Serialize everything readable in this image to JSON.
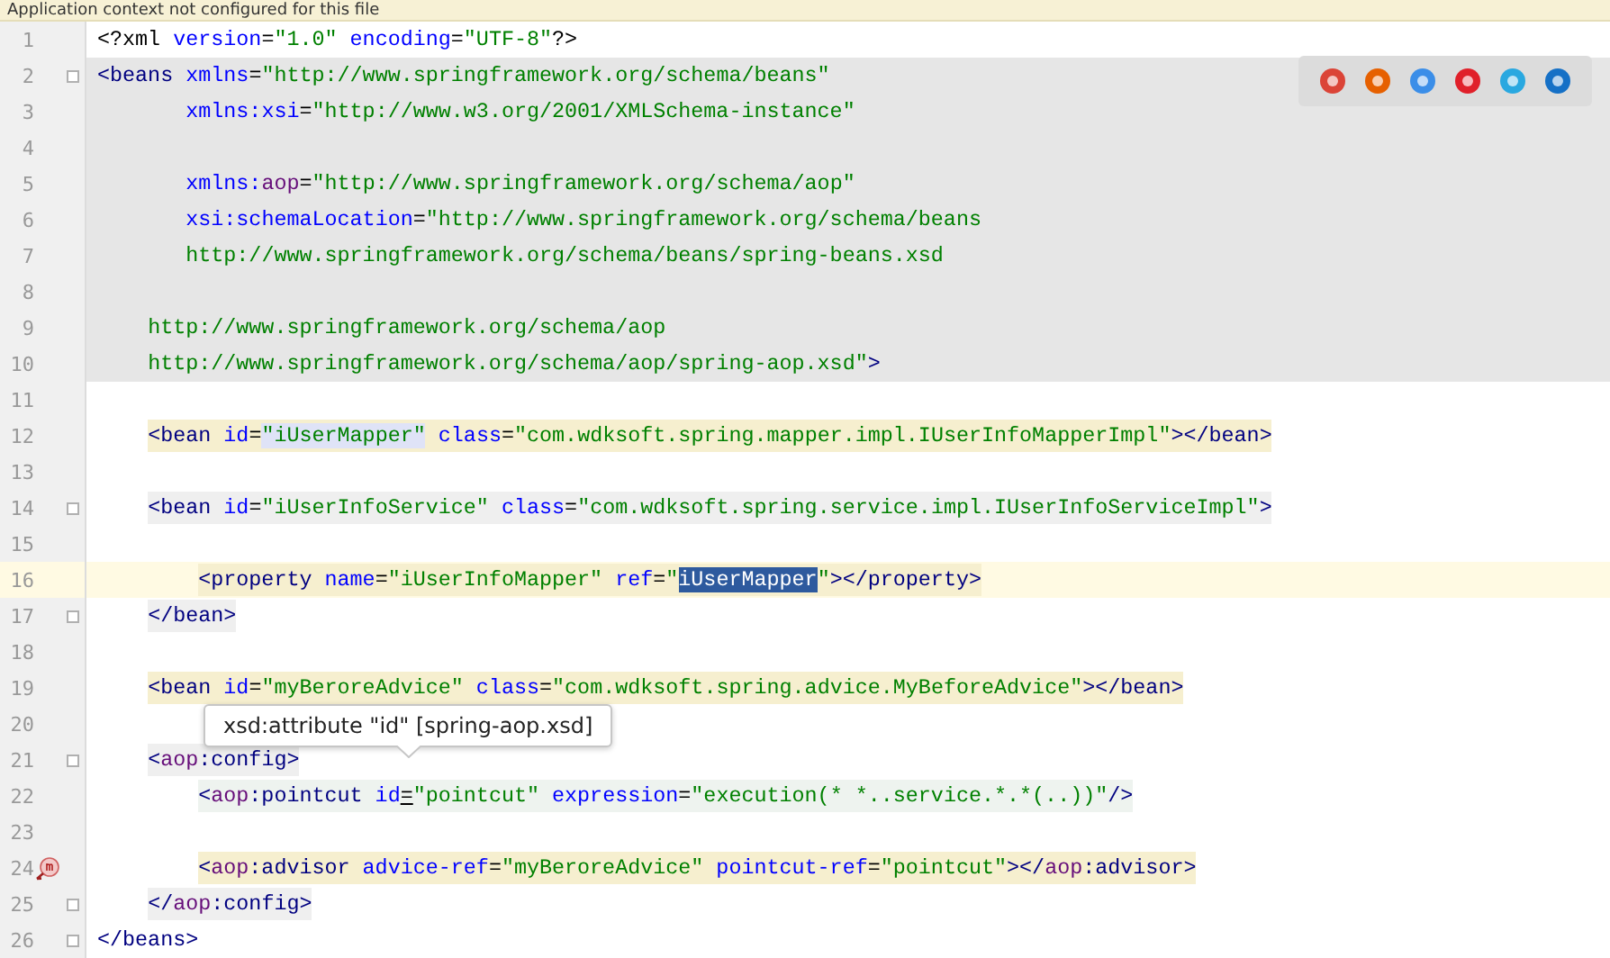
{
  "banner": {
    "text": "Application context not configured for this file"
  },
  "browser_icons": [
    {
      "color": "#db4437"
    },
    {
      "color": "#e66000"
    },
    {
      "color": "#3b8ee8"
    },
    {
      "color": "#e0202a"
    },
    {
      "color": "#29a8e0"
    },
    {
      "color": "#1570c6"
    }
  ],
  "lines": [
    {
      "number": "1",
      "band": false,
      "current": false,
      "fold": false,
      "marker": false,
      "kind": "plain",
      "tokens": [
        {
          "kind": "punct",
          "text": "<?xml"
        },
        {
          "kind": "attr",
          "text": " version"
        },
        {
          "kind": "punct",
          "text": "="
        },
        {
          "kind": "str",
          "text": "\"1.0\""
        },
        {
          "kind": "attr",
          "text": " encoding"
        },
        {
          "kind": "punct",
          "text": "="
        },
        {
          "kind": "str",
          "text": "\"UTF-8\""
        },
        {
          "kind": "punct",
          "text": "?>"
        }
      ]
    },
    {
      "number": "2",
      "band": true,
      "current": false,
      "fold": true,
      "marker": false,
      "kind": "plain",
      "tokens": [
        {
          "kind": "tag",
          "text": "<beans"
        },
        {
          "kind": "attr",
          "text": " xmlns"
        },
        {
          "kind": "punct",
          "text": "="
        },
        {
          "kind": "str",
          "text": "\"http://www.springframework.org/schema/beans\""
        }
      ]
    },
    {
      "number": "3",
      "band": true,
      "current": false,
      "fold": false,
      "marker": false,
      "kind": "plain",
      "tokens": [
        {
          "kind": "attr",
          "text": "       xmlns:xsi"
        },
        {
          "kind": "punct",
          "text": "="
        },
        {
          "kind": "str",
          "text": "\"http://www.w3.org/2001/XMLSchema-instance\""
        }
      ]
    },
    {
      "number": "4",
      "band": true,
      "current": false,
      "fold": false,
      "marker": false
    },
    {
      "number": "5",
      "band": true,
      "current": false,
      "fold": false,
      "marker": false,
      "kind": "plain",
      "tokens": [
        {
          "kind": "attr",
          "text": "       xmlns:"
        },
        {
          "kind": "ns",
          "text": "aop"
        },
        {
          "kind": "punct",
          "text": "="
        },
        {
          "kind": "str",
          "text": "\"http://www.springframework.org/schema/aop\""
        }
      ]
    },
    {
      "number": "6",
      "band": true,
      "current": false,
      "fold": false,
      "marker": false,
      "kind": "plain",
      "tokens": [
        {
          "kind": "attr",
          "text": "       xsi:schemaLocation"
        },
        {
          "kind": "punct",
          "text": "="
        },
        {
          "kind": "str",
          "text": "\"http://www.springframework.org/schema/beans"
        }
      ]
    },
    {
      "number": "7",
      "band": true,
      "current": false,
      "fold": false,
      "marker": false,
      "kind": "plain",
      "tokens": [
        {
          "kind": "str",
          "text": "       http://www.springframework.org/schema/beans/spring-beans.xsd"
        }
      ]
    },
    {
      "number": "8",
      "band": true,
      "current": false,
      "fold": false,
      "marker": false
    },
    {
      "number": "9",
      "band": true,
      "current": false,
      "fold": false,
      "marker": false,
      "kind": "plain",
      "tokens": [
        {
          "kind": "str",
          "text": "    http://www.springframework.org/schema/aop"
        }
      ]
    },
    {
      "number": "10",
      "band": true,
      "current": false,
      "fold": false,
      "marker": false,
      "kind": "plain",
      "tokens": [
        {
          "kind": "str",
          "text": "    http://www.springframework.org/schema/aop/spring-aop.xsd\""
        },
        {
          "kind": "tag",
          "text": ">"
        }
      ]
    },
    {
      "number": "11",
      "band": false,
      "current": false,
      "fold": false,
      "marker": false
    },
    {
      "number": "12",
      "band": false,
      "current": false,
      "fold": false,
      "marker": false,
      "kind": "matched",
      "tokens": [
        {
          "kind": "tag",
          "text": "    <bean"
        },
        {
          "kind": "attr",
          "text": " id"
        },
        {
          "kind": "punct",
          "text": "="
        },
        {
          "kind": "match",
          "text": "\"iUserMapper\""
        },
        {
          "kind": "attr",
          "text": " class"
        },
        {
          "kind": "punct",
          "text": "="
        },
        {
          "kind": "str",
          "text": "\"com.wdksoft.spring.mapper.impl.IUserInfoMapperImpl\""
        },
        {
          "kind": "tag",
          "text": "></bean>"
        }
      ]
    },
    {
      "number": "13",
      "band": false,
      "current": false,
      "fold": false,
      "marker": false
    },
    {
      "number": "14",
      "band": false,
      "current": false,
      "fold": true,
      "marker": false,
      "kind": "scope",
      "tokens": [
        {
          "kind": "tag",
          "text": "    <bean"
        },
        {
          "kind": "attr",
          "text": " id"
        },
        {
          "kind": "punct",
          "text": "="
        },
        {
          "kind": "str",
          "text": "\"iUserInfoService\""
        },
        {
          "kind": "attr",
          "text": " class"
        },
        {
          "kind": "punct",
          "text": "="
        },
        {
          "kind": "str",
          "text": "\"com.wdksoft.spring.service.impl.IUserInfoServiceImpl\""
        },
        {
          "kind": "tag",
          "text": ">"
        }
      ]
    },
    {
      "number": "15",
      "band": false,
      "current": false,
      "fold": false,
      "marker": false
    },
    {
      "number": "16",
      "band": false,
      "current": true,
      "fold": false,
      "marker": false,
      "kind": "matched",
      "tokens": [
        {
          "kind": "tag",
          "text": "        <property"
        },
        {
          "kind": "attr",
          "text": " name"
        },
        {
          "kind": "punct",
          "text": "="
        },
        {
          "kind": "str",
          "text": "\"iUserInfoMapper\""
        },
        {
          "kind": "attr",
          "text": " ref"
        },
        {
          "kind": "punct",
          "text": "="
        },
        {
          "kind": "str",
          "text": "\""
        },
        {
          "kind": "sel",
          "text": "iUserMapper"
        },
        {
          "kind": "str",
          "text": "\""
        },
        {
          "kind": "tag",
          "text": "></property>"
        }
      ]
    },
    {
      "number": "17",
      "band": false,
      "current": false,
      "fold": true,
      "marker": false,
      "kind": "scope",
      "tokens": [
        {
          "kind": "tag",
          "text": "    </bean>"
        }
      ]
    },
    {
      "number": "18",
      "band": false,
      "current": false,
      "fold": false,
      "marker": false
    },
    {
      "number": "19",
      "band": false,
      "current": false,
      "fold": false,
      "marker": false,
      "kind": "matched",
      "tokens": [
        {
          "kind": "tag",
          "text": "    <bean"
        },
        {
          "kind": "attr",
          "text": " id"
        },
        {
          "kind": "punct",
          "text": "="
        },
        {
          "kind": "str",
          "text": "\"myBeroreAdvice\""
        },
        {
          "kind": "attr",
          "text": " class"
        },
        {
          "kind": "punct",
          "text": "="
        },
        {
          "kind": "str",
          "text": "\"com.wdksoft.spring.advice.MyBeforeAdvice\""
        },
        {
          "kind": "tag",
          "text": "></bean>"
        }
      ]
    },
    {
      "number": "20",
      "band": false,
      "current": false,
      "fold": false,
      "marker": false
    },
    {
      "number": "21",
      "band": false,
      "current": false,
      "fold": true,
      "marker": false,
      "kind": "scope",
      "tokens": [
        {
          "kind": "tag",
          "text": "    <"
        },
        {
          "kind": "ns",
          "text": "aop"
        },
        {
          "kind": "tag",
          "text": ":config>"
        }
      ]
    },
    {
      "number": "22",
      "band": false,
      "current": false,
      "fold": false,
      "marker": false,
      "kind": "light",
      "tokens": [
        {
          "kind": "tag",
          "text": "        <"
        },
        {
          "kind": "ns",
          "text": "aop"
        },
        {
          "kind": "tag",
          "text": ":pointcut"
        },
        {
          "kind": "attr",
          "text": " id"
        },
        {
          "kind": "under",
          "text": "="
        },
        {
          "kind": "str",
          "text": "\"pointcut\""
        },
        {
          "kind": "attr",
          "text": " expression"
        },
        {
          "kind": "punct",
          "text": "="
        },
        {
          "kind": "str",
          "text": "\"execution(* *..service.*.*(..))\""
        },
        {
          "kind": "tag",
          "text": "/>"
        }
      ]
    },
    {
      "number": "23",
      "band": false,
      "current": false,
      "fold": false,
      "marker": false
    },
    {
      "number": "24",
      "band": false,
      "current": false,
      "fold": false,
      "marker": true,
      "kind": "matched",
      "tokens": [
        {
          "kind": "tag",
          "text": "        <"
        },
        {
          "kind": "ns",
          "text": "aop"
        },
        {
          "kind": "tag",
          "text": ":advisor"
        },
        {
          "kind": "attr",
          "text": " advice-ref"
        },
        {
          "kind": "punct",
          "text": "="
        },
        {
          "kind": "str",
          "text": "\"myBeroreAdvice\""
        },
        {
          "kind": "attr",
          "text": " pointcut-ref"
        },
        {
          "kind": "punct",
          "text": "="
        },
        {
          "kind": "str",
          "text": "\"pointcut\""
        },
        {
          "kind": "tag",
          "text": "></"
        },
        {
          "kind": "ns",
          "text": "aop"
        },
        {
          "kind": "tag",
          "text": ":advisor>"
        }
      ]
    },
    {
      "number": "25",
      "band": false,
      "current": false,
      "fold": true,
      "marker": false,
      "kind": "scope",
      "tokens": [
        {
          "kind": "tag",
          "text": "    </"
        },
        {
          "kind": "ns",
          "text": "aop"
        },
        {
          "kind": "tag",
          "text": ":config>"
        }
      ]
    },
    {
      "number": "26",
      "band": false,
      "current": false,
      "fold": true,
      "marker": false,
      "kind": "plain",
      "tokens": [
        {
          "kind": "tag",
          "text": "</beans>"
        }
      ]
    }
  ],
  "tooltip": {
    "text": "xsd:attribute \"id\" [spring-aop.xsd]"
  }
}
